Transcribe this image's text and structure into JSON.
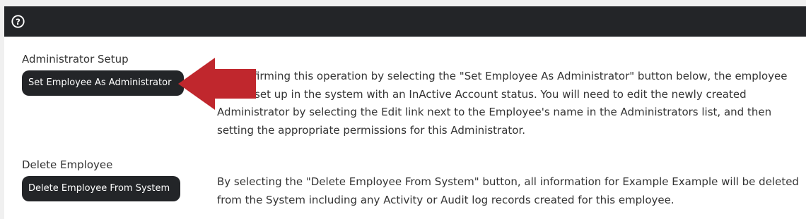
{
  "toolbar": {
    "help_icon": "question-circle-icon"
  },
  "admin_section": {
    "label": "Administrator Setup",
    "button_label": "Set Employee As Administrator",
    "description": "By confirming this operation by selecting the \"Set Employee As Administrator\" button below, the employee will be set up in the system with an InActive Account status. You will need to edit the newly created Administrator by selecting the Edit link next to the Employee's name in the Administrators list, and then setting the appropriate permissions for this Administrator."
  },
  "delete_section": {
    "label": "Delete Employee",
    "button_label": "Delete Employee From System",
    "description": "By selecting the \"Delete Employee From System\" button, all information for Example Example will be deleted from the System including any Activity or Audit log records created for this employee."
  },
  "annotation": {
    "arrow_color": "#c0272d"
  }
}
